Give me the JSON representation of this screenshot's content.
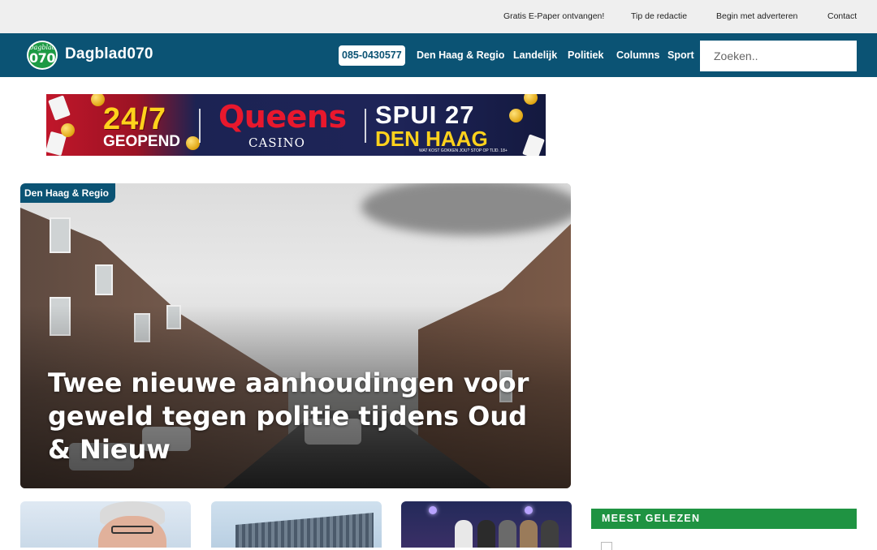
{
  "topbar": {
    "links": [
      {
        "label": "Gratis E-Paper ontvangen!"
      },
      {
        "label": "Tip de redactie"
      },
      {
        "label": "Begin met adverteren"
      },
      {
        "label": "Contact"
      }
    ]
  },
  "navbar": {
    "logo_line1": "Dagblad",
    "logo_line2": "070",
    "brand": "Dagblad070",
    "phone": "085-0430577",
    "links": [
      {
        "label": "Den Haag & Regio"
      },
      {
        "label": "Landelijk"
      },
      {
        "label": "Politiek"
      },
      {
        "label": "Columns"
      },
      {
        "label": "Sport"
      }
    ],
    "search_placeholder": "Zoeken.."
  },
  "banner": {
    "headline": "24/7",
    "subline": "GEOPEND",
    "brand": "Queens",
    "brand_sub": "CASINO",
    "address": "SPUI 27",
    "city": "DEN HAAG",
    "disclaimer": "WAT KOST GOKKEN JOU? STOP OP TIJD. 18+",
    "colors": {
      "red": "#c0162a",
      "navy": "#1c2353",
      "gold": "#ffd21c"
    }
  },
  "hero": {
    "category": "Den Haag & Regio",
    "title": "Twee nieuwe aanhoudingen voor geweld tegen politie tijdens Oud & Nieuw"
  },
  "sidebar": {
    "most_read_title": "MEEST GELEZEN"
  },
  "colors": {
    "nav": "#0b5374",
    "accent_green": "#1f9342",
    "topbar": "#efefef"
  }
}
